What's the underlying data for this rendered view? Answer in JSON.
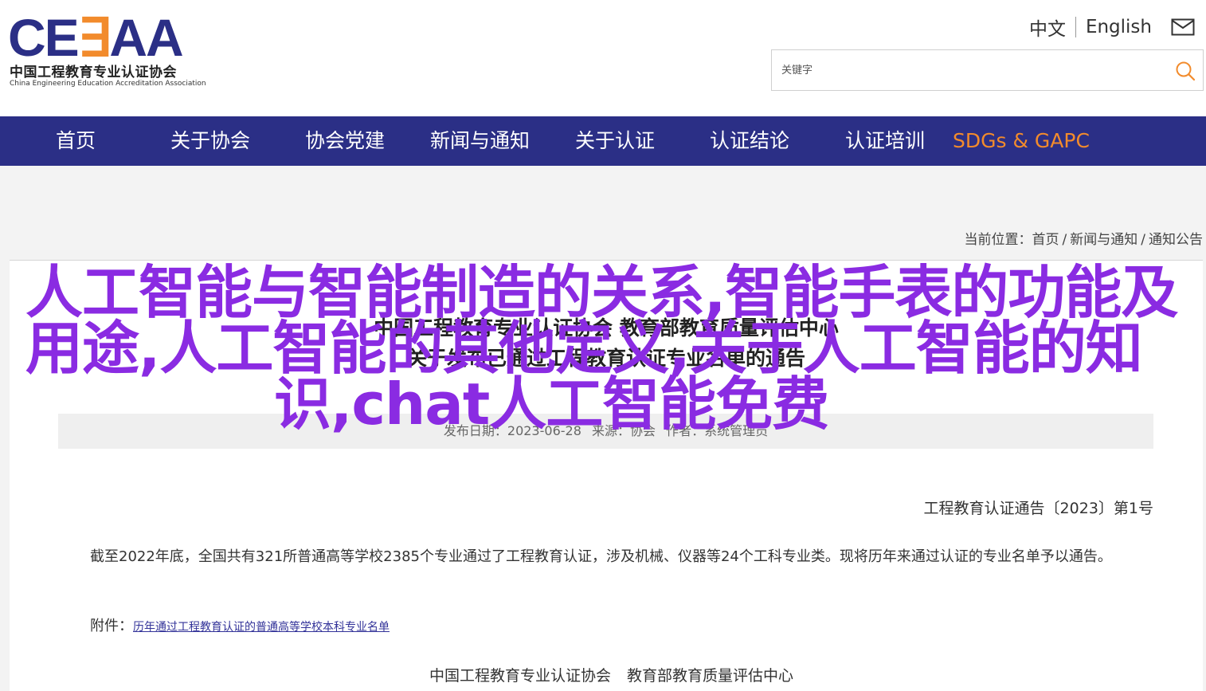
{
  "header": {
    "logo_mark_part1": "CE",
    "logo_mark_part2": "∃",
    "logo_mark_part3": "AA",
    "logo_cn": "中国工程教育专业认证协会",
    "logo_en": "China Engineering Education Accreditation Association",
    "lang_cn": "中文",
    "lang_en": "English",
    "search_placeholder": "关键字"
  },
  "nav": {
    "items": [
      {
        "label": "首页"
      },
      {
        "label": "关于协会"
      },
      {
        "label": "协会党建"
      },
      {
        "label": "新闻与通知"
      },
      {
        "label": "关于认证"
      },
      {
        "label": "认证结论"
      },
      {
        "label": "认证培训"
      },
      {
        "label": "SDGs & GAPC"
      }
    ]
  },
  "breadcrumb": {
    "prefix": "当前位置：",
    "items": [
      "首页",
      "新闻与通知",
      "通知公告"
    ]
  },
  "article": {
    "title_line1": "中国工程教育专业认证协会 教育部教育质量评估中心",
    "title_line2": "关于发布已通过工程教育认证专业名单的通告",
    "meta_date": "发布日期：2023-06-28",
    "meta_source": "来源：协会",
    "meta_author": "作者：系统管理员",
    "doc_number": "工程教育认证通告〔2023〕第1号",
    "paragraph": "截至2022年底，全国共有321所普通高等学校2385个专业通过了工程教育认证，涉及机械、仪器等24个工科专业类。现将历年来通过认证的专业名单予以通告。",
    "attachment_label": "附件：",
    "attachment_link": "历年通过工程教育认证的普通高等学校本科专业名单",
    "signature_org1": "中国工程教育专业认证协会",
    "signature_org2": "教育部教育质量评估中心"
  },
  "overlay": {
    "line1": "人工智能与智能制造的关系,智能手表的功能及",
    "line2": "用途,人工智能的其他定义,关于人工智能的知",
    "line3": "识,chat人工智能免费"
  },
  "colors": {
    "brand_navy": "#2b2f86",
    "brand_orange": "#f28b2c",
    "overlay_purple": "#8a2be2"
  }
}
